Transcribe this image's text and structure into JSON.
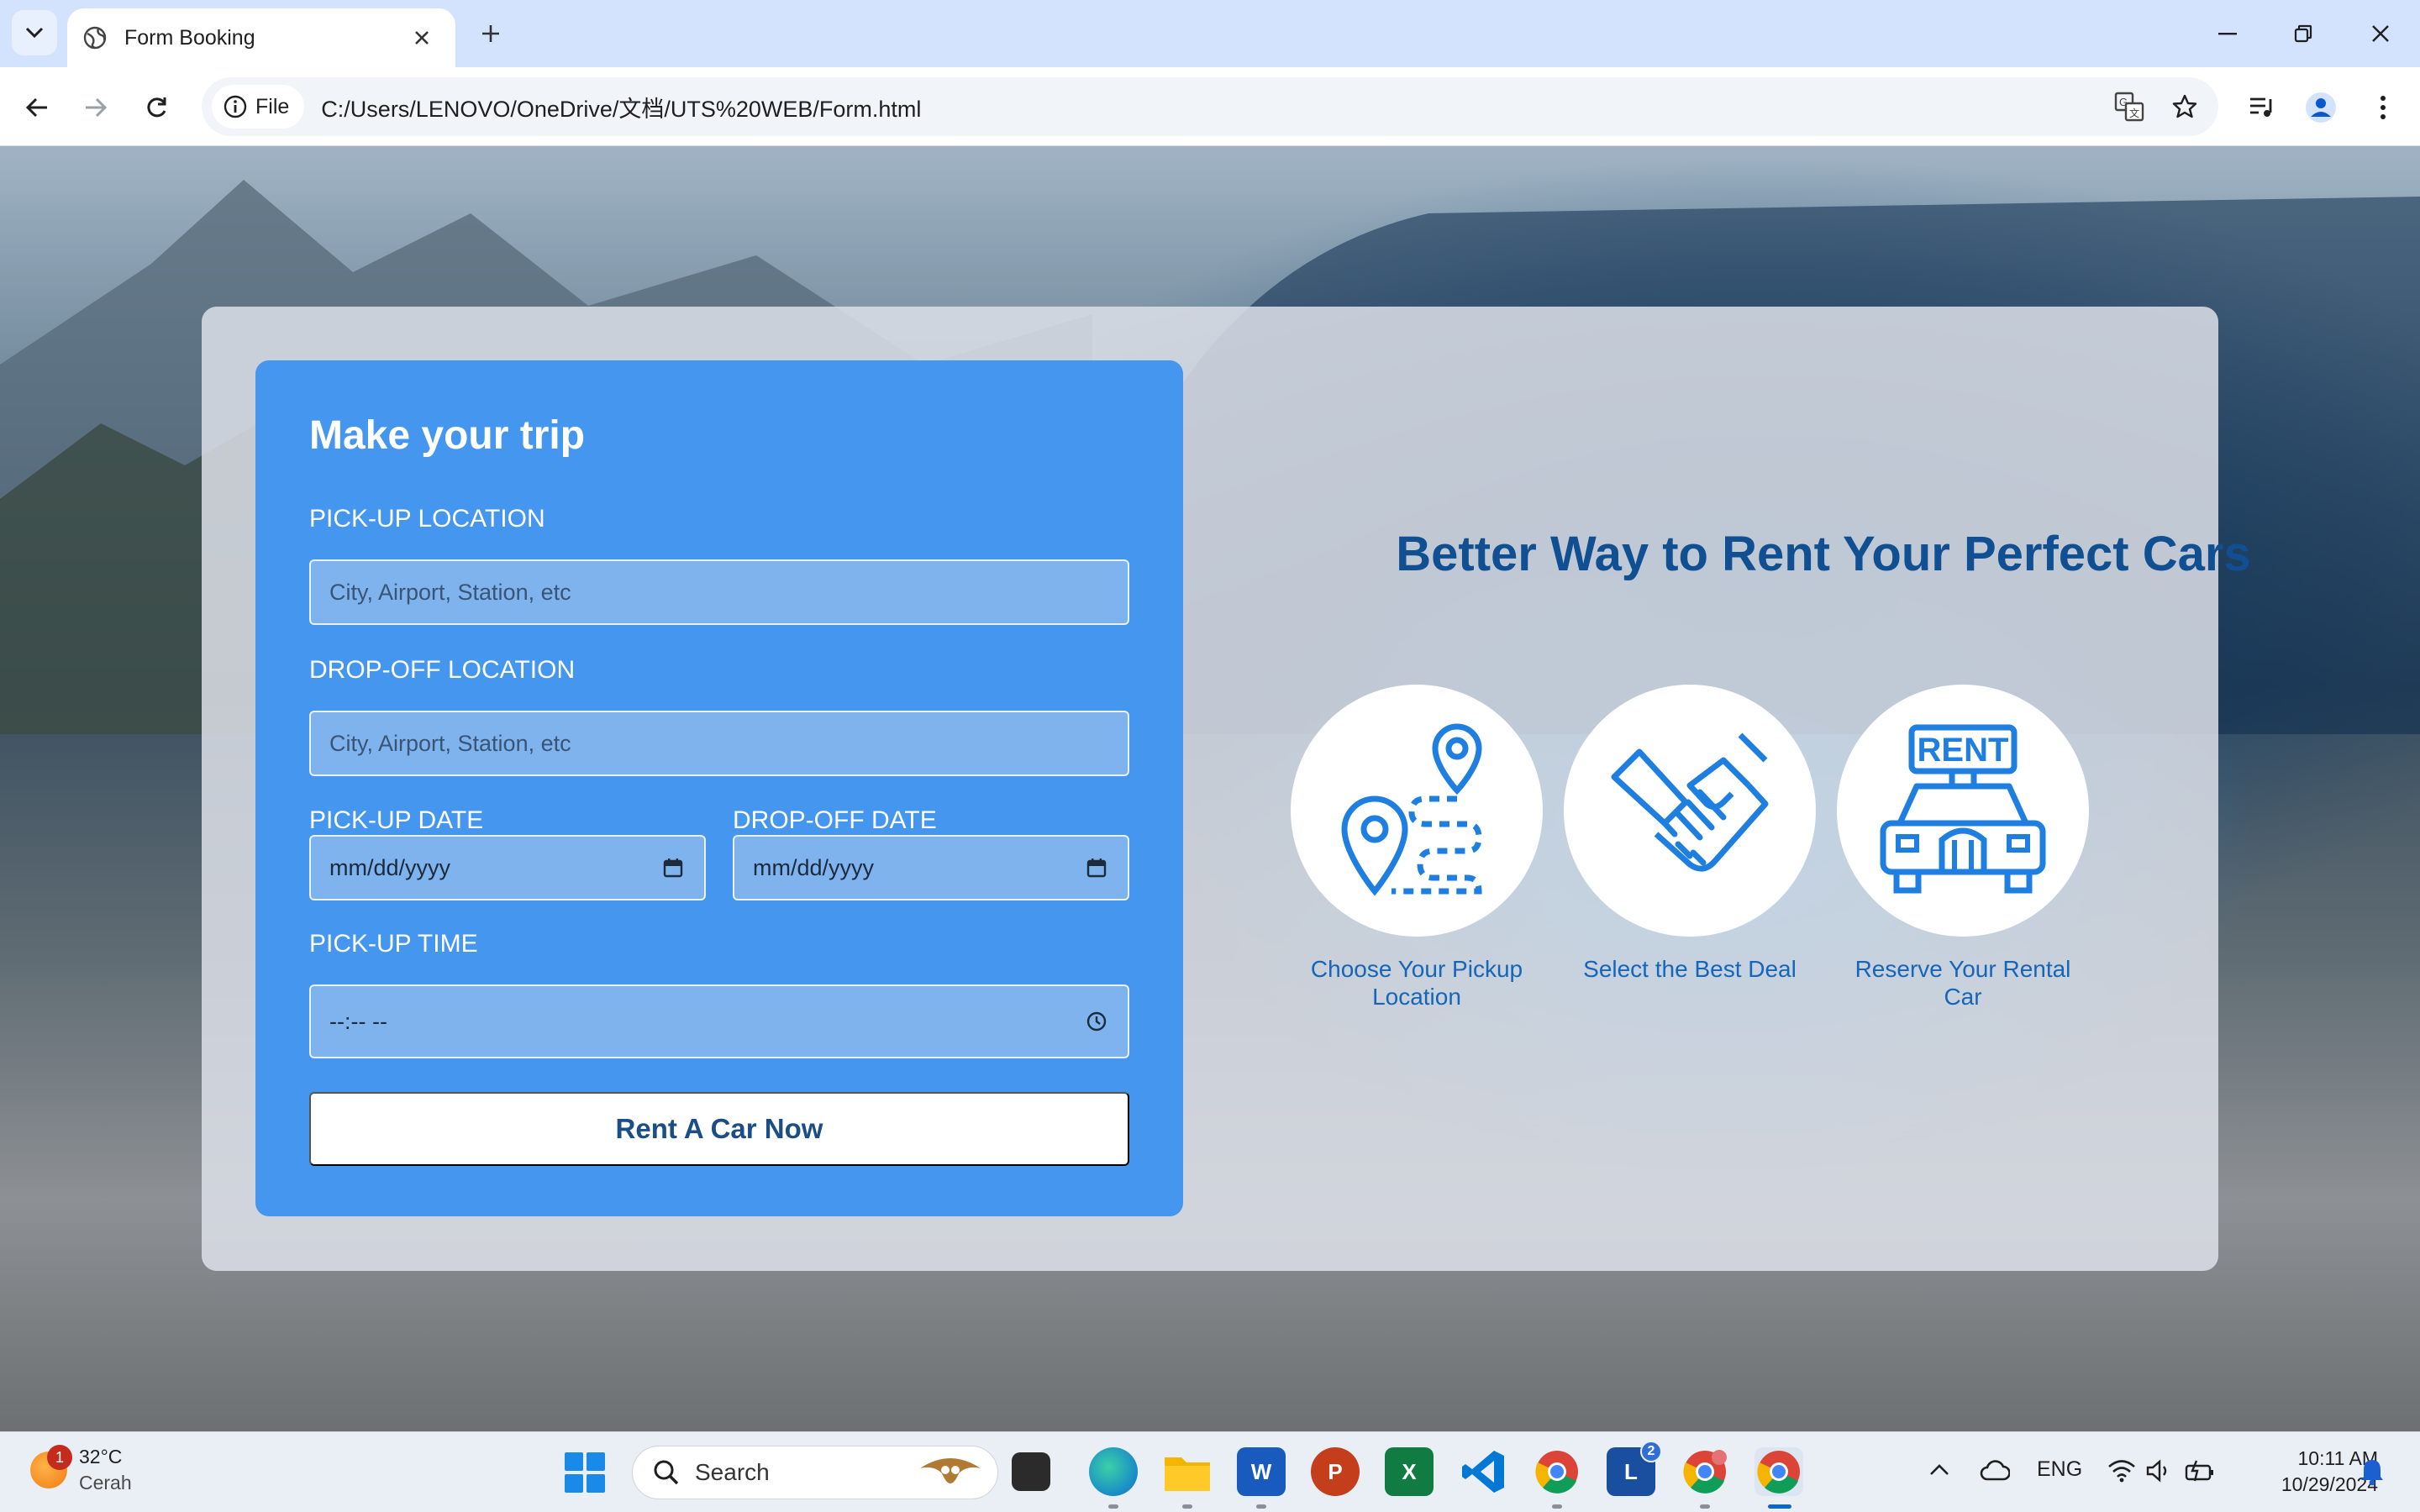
{
  "browser": {
    "tab_title": "Form Booking",
    "site_chip_label": "File",
    "url": "C:/Users/LENOVO/OneDrive/文档/UTS%20WEB/Form.html"
  },
  "form": {
    "title": "Make your trip",
    "pickup_location_label": "PICK-UP LOCATION",
    "pickup_location_placeholder": "City, Airport, Station, etc",
    "dropoff_location_label": "DROP-OFF LOCATION",
    "dropoff_location_placeholder": "City, Airport, Station, etc",
    "pickup_date_label": "PICK-UP DATE",
    "pickup_date_value": "mm/dd/yyyy",
    "dropoff_date_label": "DROP-OFF DATE",
    "dropoff_date_value": "mm/dd/yyyy",
    "pickup_time_label": "PICK-UP TIME",
    "pickup_time_value": "--:-- --",
    "submit_label": "Rent A Car Now"
  },
  "promo": {
    "title": "Better Way to Rent Your Perfect Cars",
    "features": [
      {
        "caption": "Choose Your Pickup Location",
        "icon": "location-route-icon"
      },
      {
        "caption": "Select the Best Deal",
        "icon": "handshake-icon"
      },
      {
        "caption": "Reserve Your Rental Car",
        "icon": "rent-car-icon",
        "sign_text": "RENT"
      }
    ]
  },
  "taskbar": {
    "weather_temp": "32°C",
    "weather_desc": "Cerah",
    "weather_badge": "1",
    "search_label": "Search",
    "language": "ENG",
    "time": "10:11 AM",
    "date": "10/29/2024",
    "apps": [
      {
        "name": "file-explorer-icon",
        "color": "#f4b400"
      },
      {
        "name": "word-icon",
        "label": "W",
        "color": "#185abd"
      },
      {
        "name": "powerpoint-icon",
        "label": "P",
        "color": "#c43e1c"
      },
      {
        "name": "excel-icon",
        "label": "X",
        "color": "#107c41"
      },
      {
        "name": "vscode-icon",
        "color": "#0078d4"
      },
      {
        "name": "launcher-icon",
        "label": "L",
        "badge": "2",
        "color": "#1a4fa0"
      }
    ]
  },
  "colors": {
    "form_panel": "#4596ef",
    "title_blue": "#0f4f92",
    "caption_blue": "#1565b8",
    "icon_blue": "#1e7fe0"
  }
}
